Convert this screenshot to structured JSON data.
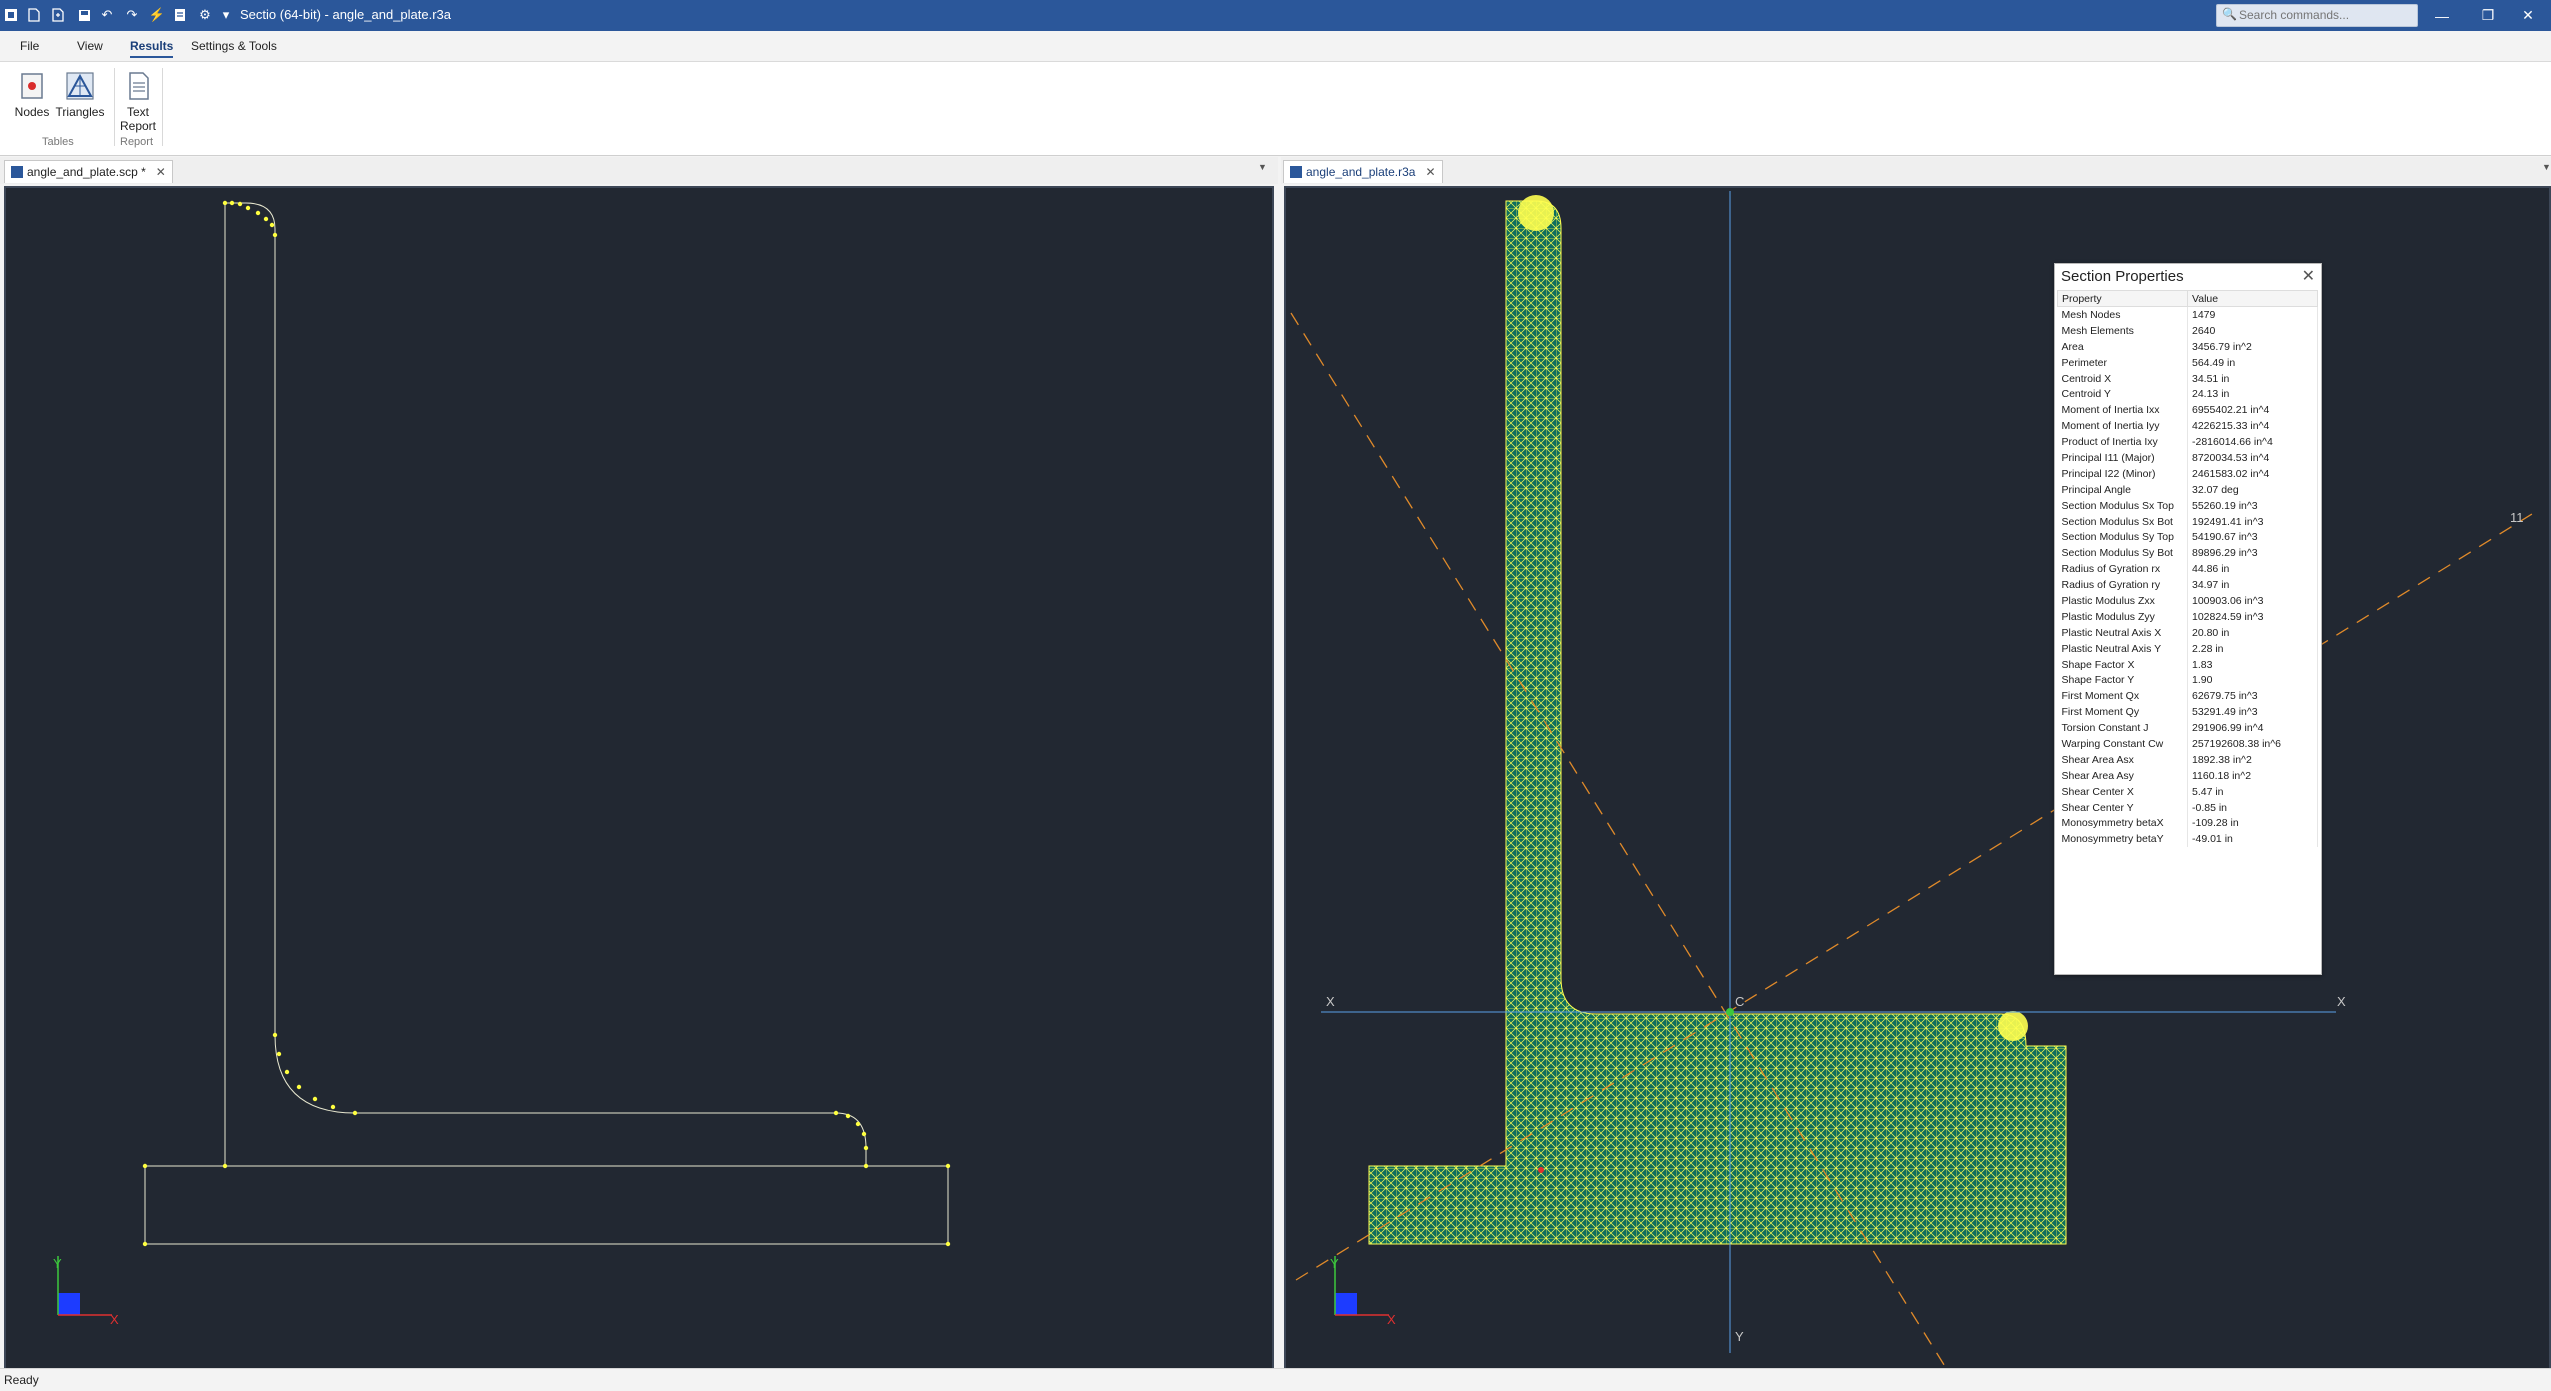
{
  "app": {
    "title": "Sectio (64-bit) - angle_and_plate.r3a",
    "search_placeholder": "Search commands...",
    "accent_color": "#2b579a"
  },
  "menu": {
    "file": "File",
    "view": "View",
    "results": "Results",
    "settings": "Settings & Tools"
  },
  "ribbon": {
    "nodes": "Nodes",
    "triangles": "Triangles",
    "text_report_1": "Text",
    "text_report_2": "Report",
    "group_tables": "Tables",
    "group_report": "Report"
  },
  "tabs": {
    "left": "angle_and_plate.scp *",
    "right": "angle_and_plate.r3a"
  },
  "viewport": {
    "axis_x": "X",
    "axis_y": "Y",
    "centroid": "C",
    "principal_axis": "11"
  },
  "section_properties": {
    "title": "Section Properties",
    "col_property": "Property",
    "col_value": "Value",
    "rows": [
      {
        "p": "Mesh Nodes",
        "v": "1479"
      },
      {
        "p": "Mesh Elements",
        "v": "2640"
      },
      {
        "p": "Area",
        "v": "3456.79 in^2"
      },
      {
        "p": "Perimeter",
        "v": "564.49 in"
      },
      {
        "p": "Centroid X",
        "v": "34.51 in"
      },
      {
        "p": "Centroid Y",
        "v": "24.13 in"
      },
      {
        "p": "Moment of Inertia Ixx",
        "v": "6955402.21 in^4"
      },
      {
        "p": "Moment of Inertia Iyy",
        "v": "4226215.33 in^4"
      },
      {
        "p": "Product of Inertia Ixy",
        "v": "-2816014.66 in^4"
      },
      {
        "p": "Principal I11 (Major)",
        "v": "8720034.53 in^4"
      },
      {
        "p": "Principal I22 (Minor)",
        "v": "2461583.02 in^4"
      },
      {
        "p": "Principal Angle",
        "v": "32.07 deg"
      },
      {
        "p": "Section Modulus Sx Top",
        "v": "55260.19 in^3"
      },
      {
        "p": "Section Modulus Sx Bot",
        "v": "192491.41 in^3"
      },
      {
        "p": "Section Modulus Sy Top",
        "v": "54190.67 in^3"
      },
      {
        "p": "Section Modulus Sy Bot",
        "v": "89896.29 in^3"
      },
      {
        "p": "Radius of Gyration rx",
        "v": "44.86 in"
      },
      {
        "p": "Radius of Gyration ry",
        "v": "34.97 in"
      },
      {
        "p": "Plastic Modulus Zxx",
        "v": "100903.06 in^3"
      },
      {
        "p": "Plastic Modulus Zyy",
        "v": "102824.59 in^3"
      },
      {
        "p": "Plastic Neutral Axis X",
        "v": "20.80 in"
      },
      {
        "p": "Plastic Neutral Axis Y",
        "v": "2.28 in"
      },
      {
        "p": "Shape Factor X",
        "v": "1.83"
      },
      {
        "p": "Shape Factor Y",
        "v": "1.90"
      },
      {
        "p": "First Moment Qx",
        "v": "62679.75 in^3"
      },
      {
        "p": "First Moment Qy",
        "v": "53291.49 in^3"
      },
      {
        "p": "Torsion Constant J",
        "v": "291906.99 in^4"
      },
      {
        "p": "Warping Constant Cw",
        "v": "257192608.38 in^6"
      },
      {
        "p": "Shear Area Asx",
        "v": "1892.38 in^2"
      },
      {
        "p": "Shear Area Asy",
        "v": "1160.18 in^2"
      },
      {
        "p": "Shear Center X",
        "v": "5.47 in"
      },
      {
        "p": "Shear Center Y",
        "v": "-0.85 in"
      },
      {
        "p": "Monosymmetry betaX",
        "v": "-109.28 in"
      },
      {
        "p": "Monosymmetry betaY",
        "v": "-49.01 in"
      }
    ]
  },
  "status": {
    "text": "Ready"
  },
  "icons": {
    "app": "sectio-app-icon",
    "new": "new-file-icon",
    "open": "open-file-icon",
    "save": "save-icon",
    "undo": "undo-icon",
    "redo": "redo-icon",
    "run": "run-icon",
    "report": "report-icon",
    "settings": "settings-icon"
  }
}
